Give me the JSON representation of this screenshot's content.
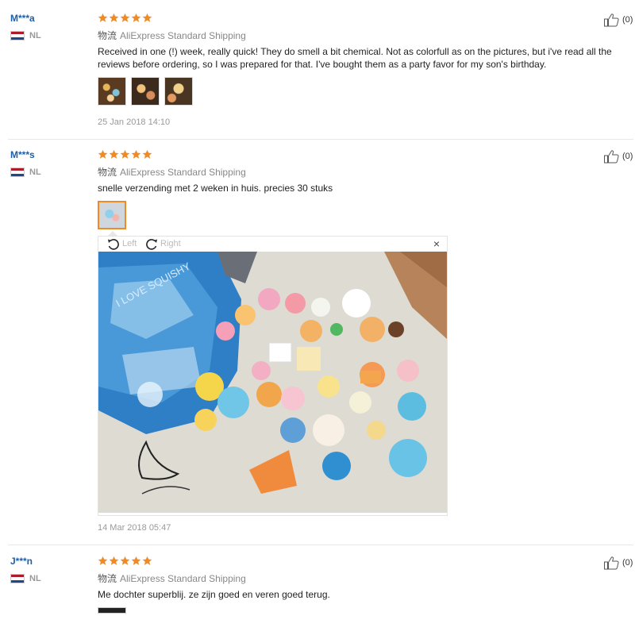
{
  "reviews": [
    {
      "user": "M***a",
      "country": "NL",
      "rating": 5,
      "shipping_label": "物流",
      "shipping": "AliExpress Standard Shipping",
      "text": "Received in one (!) week, really quick! They do smell a bit chemical. Not as colorfull as on the pictures, but i've read all the reviews before ordering, so I was prepared for that. I've bought them as a party favor for my son's birthday.",
      "date": "25 Jan 2018 14:10",
      "likes": "(0)"
    },
    {
      "user": "M***s",
      "country": "NL",
      "rating": 5,
      "shipping_label": "物流",
      "shipping": "AliExpress Standard Shipping",
      "text": "snelle verzending met 2 weken in huis. precies 30 stuks",
      "date": "14 Mar 2018 05:47",
      "likes": "(0)"
    },
    {
      "user": "J***n",
      "country": "NL",
      "rating": 5,
      "shipping_label": "物流",
      "shipping": "AliExpress Standard Shipping",
      "text": "Me dochter superblij. ze zijn goed en veren goed terug.",
      "likes": "(0)"
    }
  ],
  "viewer": {
    "rotate_left": "Left",
    "rotate_right": "Right",
    "close": "×",
    "bag_print": "I LOVE SQUISHY"
  },
  "colors": {
    "star": "#f08a24",
    "username": "#1f5fa8",
    "selected_thumb_border": "#f08a24"
  },
  "icons": {
    "rating": "star-icon",
    "likes": "thumbs-up-icon",
    "rotate_left": "rotate-left-icon",
    "rotate_right": "rotate-right-icon",
    "close": "close-icon"
  }
}
